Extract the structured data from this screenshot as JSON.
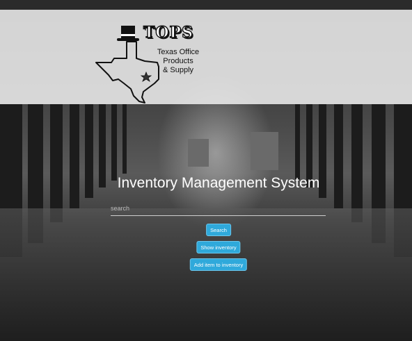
{
  "logo": {
    "brand": "TOPS",
    "subtitle_lines": [
      "Texas Office",
      "Products",
      "& Supply"
    ],
    "icons": [
      "top-hat-icon",
      "texas-outline-icon",
      "star-icon"
    ]
  },
  "main": {
    "title": "Inventory Management System",
    "search": {
      "placeholder": "search",
      "value": ""
    },
    "buttons": {
      "search": "Search",
      "show_inventory": "Show inventory",
      "add_item": "Add item to inventory"
    }
  },
  "colors": {
    "button": "#2fa9db",
    "header_band": "#ececec",
    "text": "#ffffff"
  }
}
